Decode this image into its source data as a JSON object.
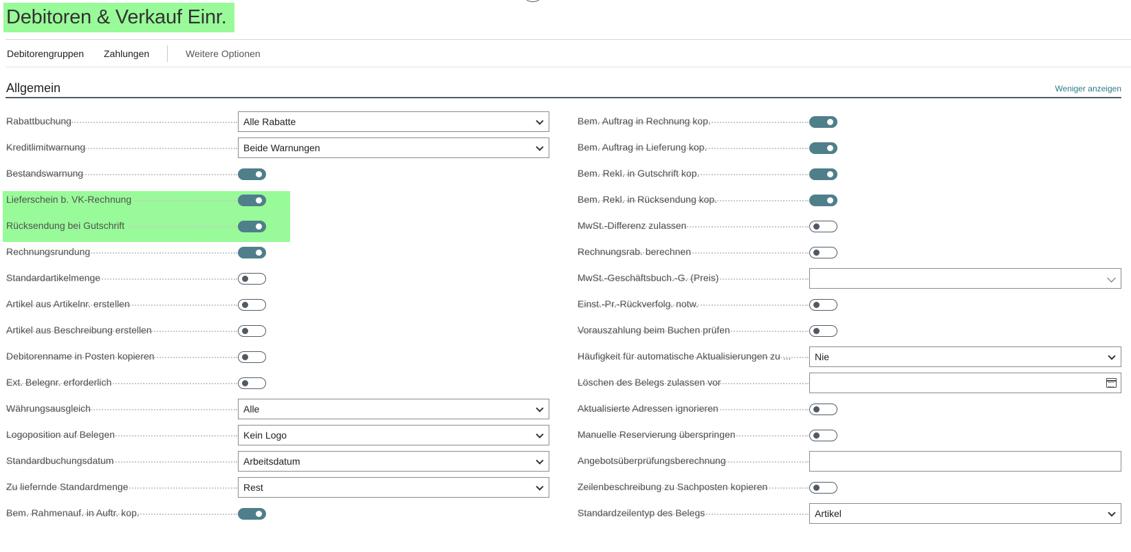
{
  "page": {
    "title": "Debitoren & Verkauf Einr."
  },
  "actions": {
    "customer_groups": "Debitorengruppen",
    "payments": "Zahlungen",
    "more_options": "Weitere Optionen"
  },
  "section": {
    "title": "Allgemein",
    "collapse_link": "Weniger anzeigen"
  },
  "left_fields": [
    {
      "label": "Rabattbuchung",
      "type": "select",
      "value": "Alle Rabatte"
    },
    {
      "label": "Kreditlimitwarnung",
      "type": "select",
      "value": "Beide Warnungen"
    },
    {
      "label": "Bestandswarnung",
      "type": "toggle",
      "value": true
    },
    {
      "label": "Lieferschein b. VK-Rechnung",
      "type": "toggle",
      "value": true
    },
    {
      "label": "Rücksendung bei Gutschrift",
      "type": "toggle",
      "value": true
    },
    {
      "label": "Rechnungsrundung",
      "type": "toggle",
      "value": true
    },
    {
      "label": "Standardartikelmenge",
      "type": "toggle",
      "value": false
    },
    {
      "label": "Artikel aus Artikelnr. erstellen",
      "type": "toggle",
      "value": false
    },
    {
      "label": "Artikel aus Beschreibung erstellen",
      "type": "toggle",
      "value": false
    },
    {
      "label": "Debitorenname in Posten kopieren",
      "type": "toggle",
      "value": false
    },
    {
      "label": "Ext. Belegnr. erforderlich",
      "type": "toggle",
      "value": false
    },
    {
      "label": "Währungsausgleich",
      "type": "select",
      "value": "Alle"
    },
    {
      "label": "Logoposition auf Belegen",
      "type": "select",
      "value": "Kein Logo"
    },
    {
      "label": "Standardbuchungsdatum",
      "type": "select",
      "value": "Arbeitsdatum"
    },
    {
      "label": "Zu liefernde Standardmenge",
      "type": "select",
      "value": "Rest"
    },
    {
      "label": "Bem. Rahmenauf. in Auftr. kop.",
      "type": "toggle",
      "value": true
    }
  ],
  "right_fields": [
    {
      "label": "Bem. Auftrag in Rechnung kop.",
      "type": "toggle",
      "value": true
    },
    {
      "label": "Bem. Auftrag in Lieferung kop.",
      "type": "toggle",
      "value": true
    },
    {
      "label": "Bem. Rekl. in Gutschrift kop.",
      "type": "toggle",
      "value": true
    },
    {
      "label": "Bem. Rekl. in Rücksendung kop.",
      "type": "toggle",
      "value": true
    },
    {
      "label": "MwSt.-Differenz zulassen",
      "type": "toggle",
      "value": false
    },
    {
      "label": "Rechnungsrab. berechnen",
      "type": "toggle",
      "value": false
    },
    {
      "label": "MwSt.-Geschäftsbuch.-G. (Preis)",
      "type": "combo",
      "value": ""
    },
    {
      "label": "Einst.-Pr.-Rückverfolg. notw.",
      "type": "toggle",
      "value": false
    },
    {
      "label": "Vorauszahlung beim Buchen prüfen",
      "type": "toggle",
      "value": false
    },
    {
      "label": "Häufigkeit für automatische Aktualisierungen zu ...",
      "type": "select",
      "value": "Nie"
    },
    {
      "label": "Löschen des Belegs zulassen vor",
      "type": "date",
      "value": ""
    },
    {
      "label": "Aktualisierte Adressen ignorieren",
      "type": "toggle",
      "value": false
    },
    {
      "label": "Manuelle Reservierung überspringen",
      "type": "toggle",
      "value": false
    },
    {
      "label": "Angebotsüberprüfungsberechnung",
      "type": "text",
      "value": ""
    },
    {
      "label": "Zeilenbeschreibung zu Sachposten kopieren",
      "type": "toggle",
      "value": false
    },
    {
      "label": "Standardzeilentyp des Belegs",
      "type": "select",
      "value": "Artikel"
    }
  ],
  "colors": {
    "highlight": "#98fa98",
    "toggle_on": "#4f7f8a",
    "link": "#2b7a8a"
  },
  "icons": {
    "dropdown": "chevron-down-icon",
    "date": "calendar-icon"
  }
}
